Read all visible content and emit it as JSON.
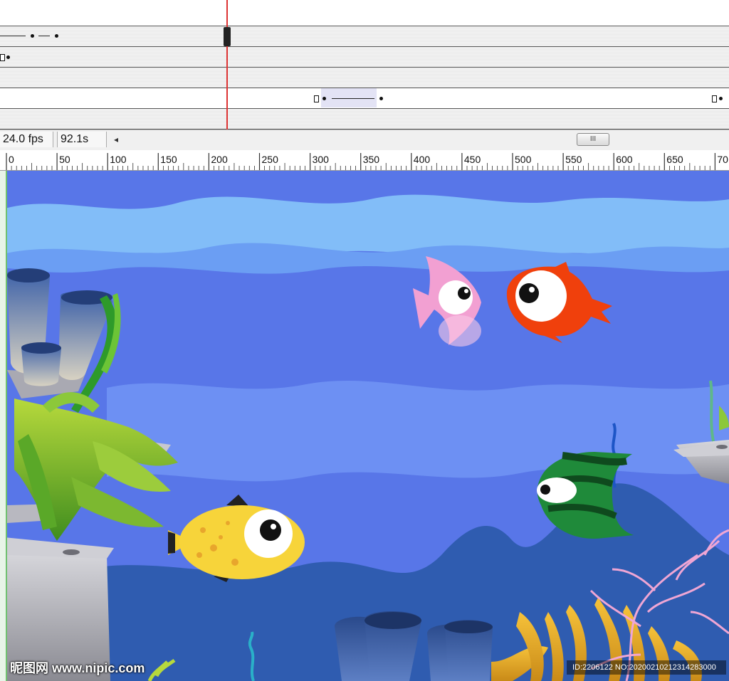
{
  "status": {
    "fps": "24.0 fps",
    "elapsed": "92.1s",
    "scroll_left_glyph": "◂",
    "scroll_thumb_glyph": "III"
  },
  "ruler": {
    "labels": [
      "0",
      "50",
      "100",
      "150",
      "200",
      "250",
      "300",
      "350",
      "400",
      "450",
      "500",
      "550",
      "600",
      "650",
      "70"
    ]
  },
  "timeline": {
    "current_frame_marker": "playhead"
  },
  "stage": {
    "colors": {
      "water_deep": "#5876e8",
      "water_light": "#7eb8f8",
      "water_mid": "#6c9cf2",
      "seabed": "#2f5cb0",
      "rock": "#9d9ea6",
      "pink_fish": "#f2a0d2",
      "red_fish": "#f0400c",
      "yellow_fish": "#f7d43a",
      "green_fish": "#1f8a3a"
    },
    "icons": [
      "pink-fish-icon",
      "red-fish-icon",
      "yellow-fish-icon",
      "green-striped-fish-icon",
      "seaweed-icon",
      "coral-icon",
      "rock-icon",
      "sponge-icon"
    ]
  },
  "watermark": {
    "left": "昵图网 www.nipic.com",
    "right": "ID:2206122 NO:20200210212314283000"
  }
}
